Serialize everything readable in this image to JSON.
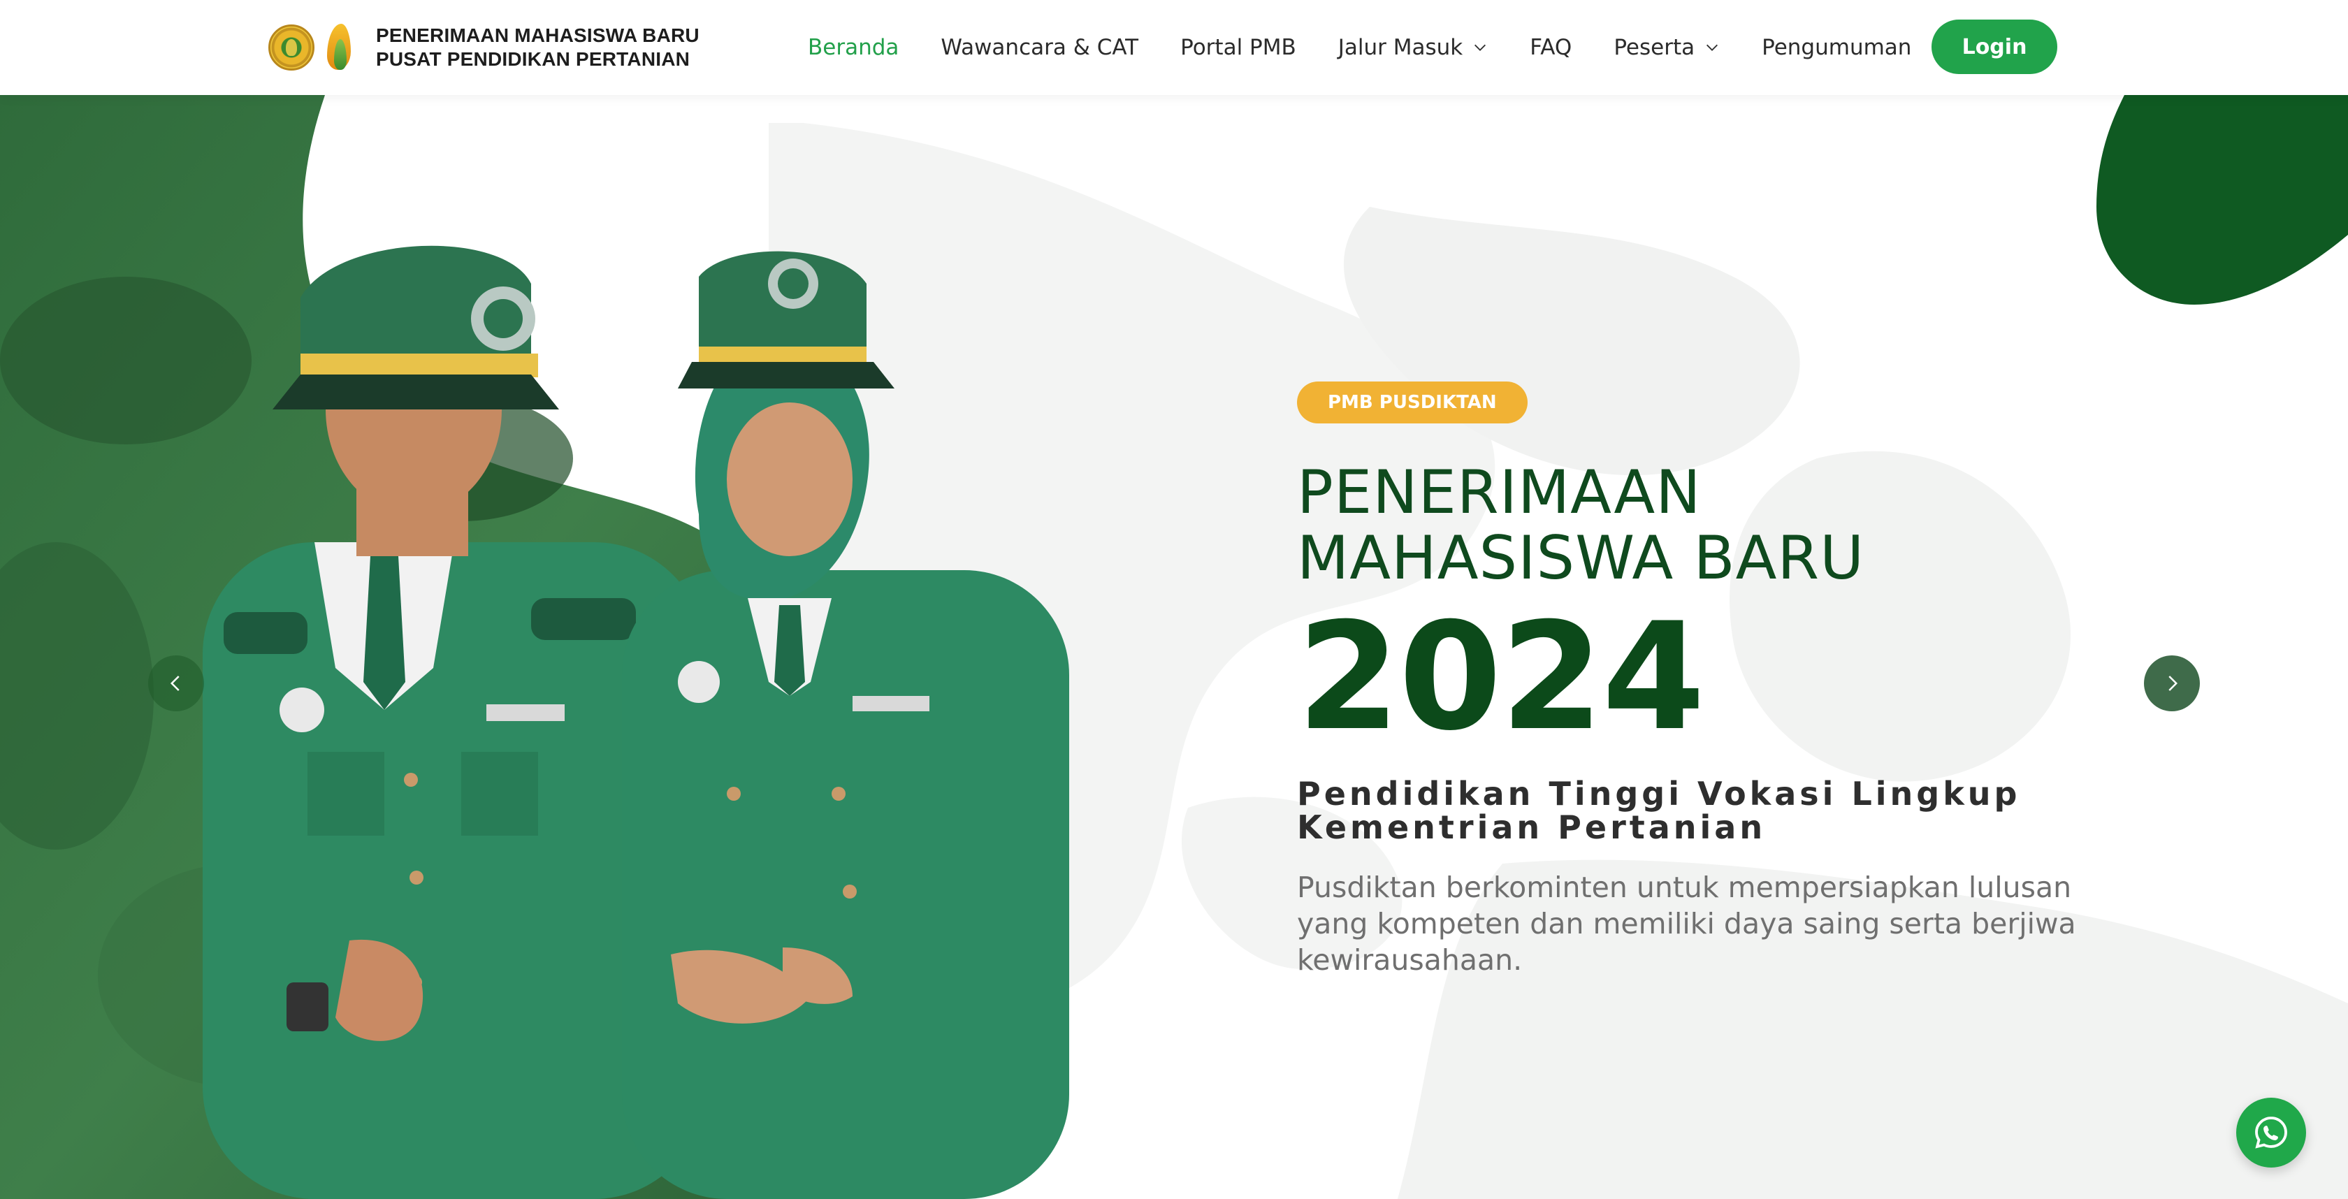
{
  "brand": {
    "line1": "PENERIMAAN MAHASISWA BARU",
    "line2": "PUSAT PENDIDIKAN PERTANIAN"
  },
  "nav": {
    "items": [
      {
        "label": "Beranda",
        "active": true
      },
      {
        "label": "Wawancara & CAT"
      },
      {
        "label": "Portal PMB"
      },
      {
        "label": "Jalur Masuk",
        "dropdown": true
      },
      {
        "label": "FAQ"
      },
      {
        "label": "Peserta",
        "dropdown": true
      },
      {
        "label": "Pengumuman"
      }
    ],
    "login_label": "Login"
  },
  "hero": {
    "badge": "PMB PUSDIKTAN",
    "title_line1": "PENERIMAAN",
    "title_line2": "MAHASISWA BARU",
    "year": "2024",
    "subtitle_line1": "Pendidikan Tinggi Vokasi Lingkup",
    "subtitle_line2": "Kementrian Pertanian",
    "description": "Pusdiktan berkominten untuk mempersiapkan lulusan yang kompeten dan memiliki daya saing serta berjiwa kewirausahaan."
  },
  "icons": {
    "prev": "chevron-left-icon",
    "next": "chevron-right-icon",
    "dropdown": "chevron-down-icon",
    "whatsapp": "whatsapp-icon"
  },
  "colors": {
    "accent": "#22a04a",
    "badge": "#f1b234",
    "title": "#0f4a1e",
    "dark_green": "#0c4a1a"
  }
}
